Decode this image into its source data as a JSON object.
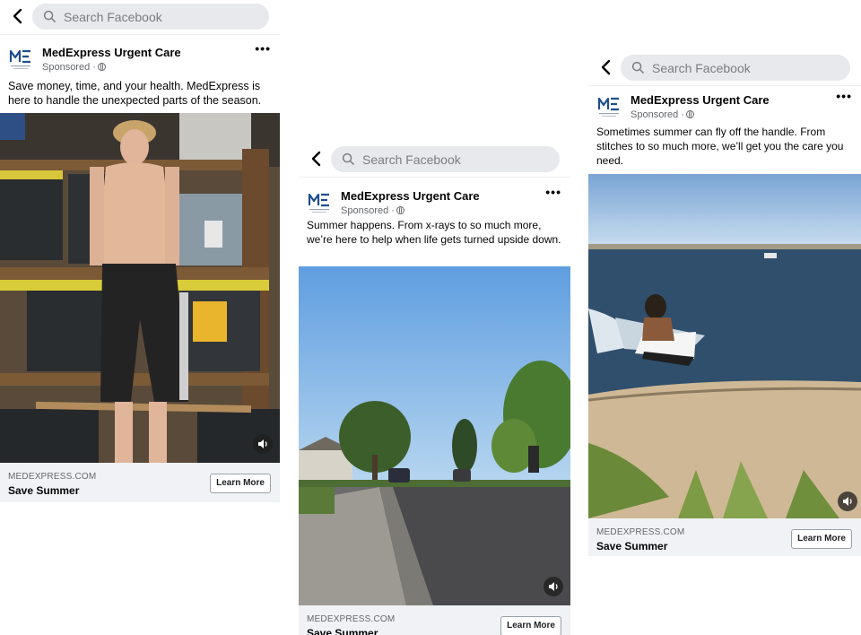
{
  "search": {
    "placeholder": "Search Facebook"
  },
  "ads": [
    {
      "page_name": "MedExpress Urgent Care",
      "sponsored": "Sponsored ·",
      "text": "Save money, time, and your health. MedExpress is here to handle the unexpected parts of the season.",
      "domain": "MEDEXPRESS.COM",
      "headline": "Save Summer",
      "cta": "Learn More"
    },
    {
      "page_name": "MedExpress Urgent Care",
      "sponsored": "Sponsored ·",
      "text": "Summer happens. From x-rays to so much more, we’re here to help when life gets turned upside down.",
      "domain": "MEDEXPRESS.COM",
      "headline": "Save Summer",
      "cta": "Learn More"
    },
    {
      "page_name": "MedExpress Urgent Care",
      "sponsored": "Sponsored ·",
      "text": "Sometimes summer can fly off the handle. From stitches to so much more, we’ll get you the care you need.",
      "domain": "MEDEXPRESS.COM",
      "headline": "Save Summer",
      "cta": "Learn More"
    }
  ],
  "icons": [
    "back-arrow-icon",
    "search-icon",
    "medexpress-logo",
    "globe-icon",
    "more-options-icon",
    "sound-icon"
  ],
  "colors": {
    "search_bg": "#e7e9ec",
    "cta_bar_bg": "#f0f2f5",
    "text": "#050505",
    "muted": "#65676b",
    "brand_blue": "#1f4e8c"
  }
}
